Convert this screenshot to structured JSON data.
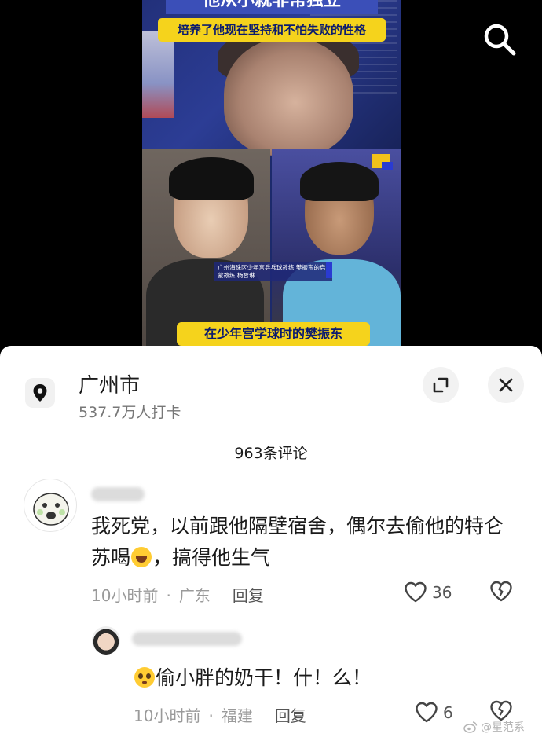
{
  "video": {
    "title_strip": "他从小就非常独立",
    "sub_banner": "培养了他现在坚持和不怕失败的性格",
    "caption_small": "广州海珠区少年宫乒乓球教练 樊振东的启蒙教练 杨智琳",
    "bottom_banner": "在少年宫学球时的樊振东"
  },
  "location": {
    "title": "广州市",
    "checkins": "537.7万人打卡"
  },
  "comments_header": "963条评论",
  "comments": [
    {
      "text_before_emoji": "我死党，以前跟他隔壁宿舍，偶尔去偷他的特仑苏喝",
      "emoji": "laughing-emoji",
      "text_after_emoji": "，搞得他生气",
      "time": "10小时前",
      "region": "广东",
      "reply_label": "回复",
      "likes": "36"
    },
    {
      "emoji": "pleading-emoji",
      "text": "偷小胖的奶干！什！么！",
      "time": "10小时前",
      "region": "福建",
      "reply_label": "回复",
      "likes": "6"
    }
  ],
  "watermark": "@星范系",
  "icons": [
    "search-icon",
    "location-pin-icon",
    "expand-icon",
    "close-icon",
    "heart-icon",
    "broken-heart-icon",
    "weibo-icon"
  ]
}
